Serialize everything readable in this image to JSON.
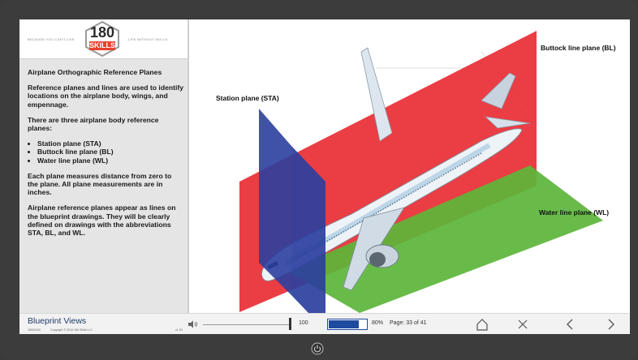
{
  "header": {
    "tagline_left": "BECAUSE YOU CAN'T LIVE",
    "tagline_right": "LIFE WITHOUT SKILLS",
    "logo_number": "180",
    "logo_word": "SKILLS"
  },
  "content": {
    "title": "Airplane Orthographic Reference Planes",
    "p1": "Reference planes and lines are used to identify locations on the airplane body, wings, and empennage.",
    "p2": "There are three airplane body reference planes:",
    "list": [
      "Station plane (STA)",
      "Buttock line plane (BL)",
      "Water line plane (WL)"
    ],
    "p3": "Each plane measures distance from zero to the plane. All plane measurements are in inches.",
    "p4": "Airplane reference planes appear as lines on the blueprint drawings. They will be clearly defined on drawings with the abbreviations STA, BL, and WL."
  },
  "diagram": {
    "label_sta": "Station plane (STA)",
    "label_bl": "Buttock line plane (BL)",
    "label_wl": "Water line plane (WL)",
    "colors": {
      "sta": "#2b3f9e",
      "bl": "#e8222a",
      "wl": "#5cb53a"
    }
  },
  "footer": {
    "course_title": "Blueprint Views",
    "code": "18000100",
    "copyright": "Copyright © 2016 180 Skills LLC",
    "version": "v1.00",
    "volume": "100",
    "volume_level": 1.0,
    "progress_text": "80%",
    "progress_value": 0.8,
    "page_text": "Page: 33 of 41",
    "icons": [
      "speaker-icon",
      "home-icon",
      "close-icon",
      "chevron-left-icon",
      "chevron-right-icon",
      "power-icon"
    ]
  }
}
